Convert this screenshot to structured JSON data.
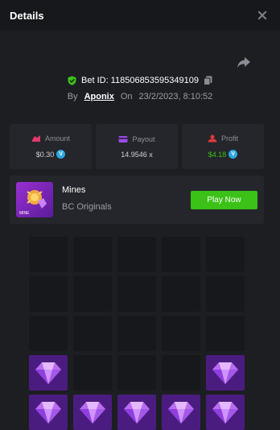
{
  "header": {
    "title": "Details"
  },
  "bet": {
    "id_label": "Bet ID: 118506853595349109",
    "by_label": "By",
    "user": "Aponix",
    "on_label": "On",
    "date": "23/2/2023, 8:10:52"
  },
  "stats": {
    "amount": {
      "label": "Amount",
      "value": "$0.30"
    },
    "payout": {
      "label": "Payout",
      "value": "14.9546 x"
    },
    "profit": {
      "label": "Profit",
      "value": "$4.18"
    }
  },
  "coin": {
    "glyph": "V"
  },
  "game": {
    "name": "Mines",
    "provider": "BC Originals",
    "play_label": "Play Now",
    "thumb_label": "MINE"
  },
  "board": {
    "columns": 5,
    "tiles": [
      "hidden",
      "hidden",
      "hidden",
      "hidden",
      "hidden",
      "hidden",
      "hidden",
      "hidden",
      "hidden",
      "hidden",
      "hidden",
      "hidden",
      "hidden",
      "hidden",
      "hidden",
      "gem",
      "hidden",
      "hidden",
      "hidden",
      "gem",
      "gem",
      "gem",
      "gem",
      "gem",
      "gem"
    ]
  },
  "colors": {
    "accent_green": "#3bc117",
    "gem_tile": "#4b1c80",
    "hidden_tile": "#17181b",
    "coin": "#2ea7e0"
  }
}
